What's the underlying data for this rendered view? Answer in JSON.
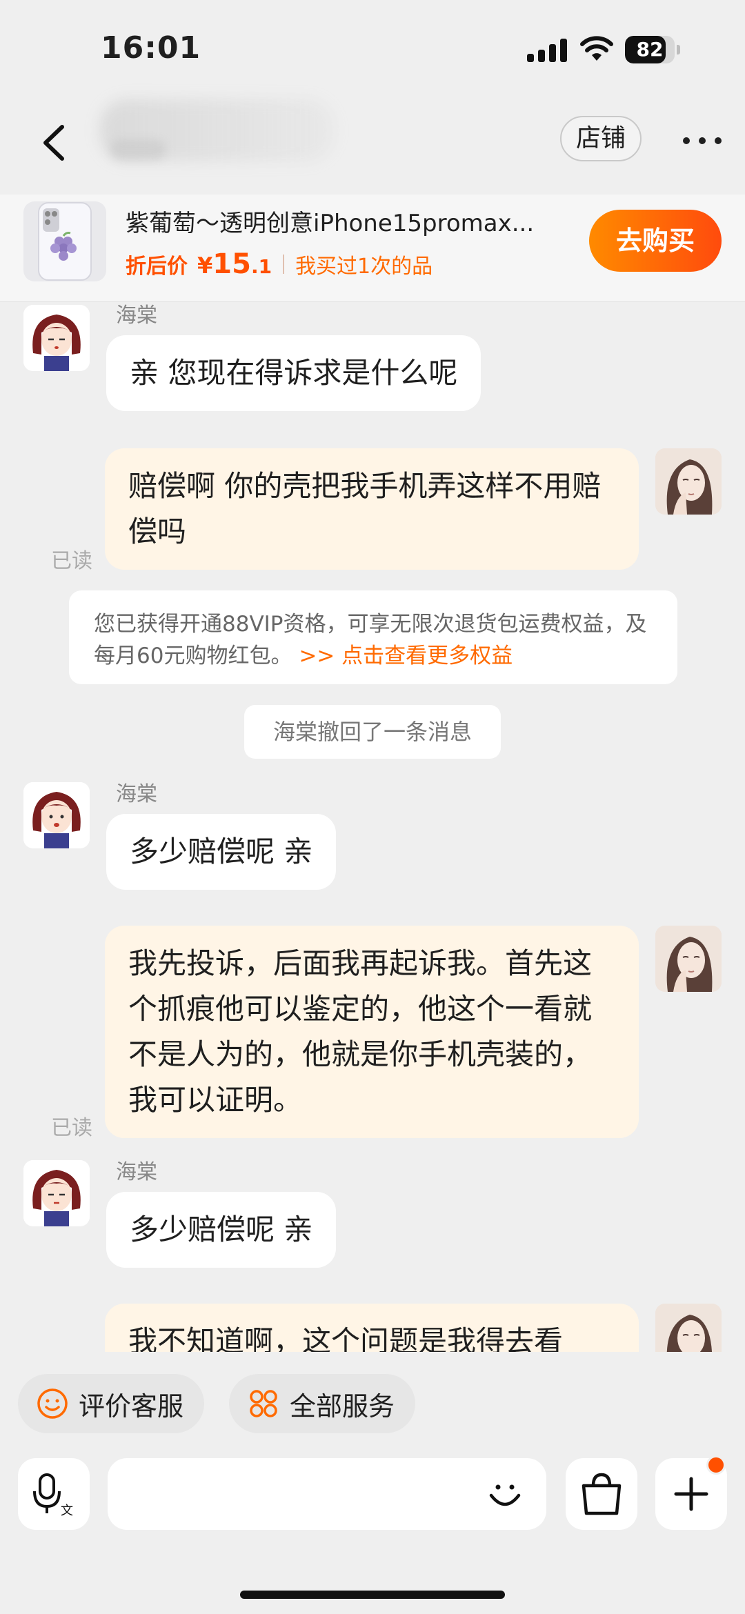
{
  "status_bar": {
    "time": "16:01",
    "battery": "82",
    "battery_level": 0.82
  },
  "header": {
    "store_label": "店铺"
  },
  "product": {
    "title": "紫葡萄～透明创意iPhone15promax...",
    "price_label": "折后价",
    "price_symbol": "¥",
    "price_integer": "15",
    "price_decimal": ".1",
    "bought_text": "我买过1次的品",
    "buy_label": "去购买"
  },
  "chat": {
    "agent_name": "海棠",
    "read_label": "已读",
    "messages": [
      {
        "sender": "agent",
        "text": "亲 您现在得诉求是什么呢"
      },
      {
        "sender": "user",
        "text": "赔偿啊 你的壳把我手机弄这样不用赔偿吗"
      },
      {
        "sender": "agent",
        "text": "多少赔偿呢 亲"
      },
      {
        "sender": "user",
        "text": "我先投诉，后面我再起诉我。首先这个抓痕他可以鉴定的，他这个一看就不是人为的，他就是你手机壳装的，我可以证明。"
      },
      {
        "sender": "agent",
        "text": "多少赔偿呢 亲"
      },
      {
        "sender": "user",
        "text": "我不知道啊，这个问题是我得去看"
      }
    ],
    "vip_notice": "您已获得开通88VIP资格，可享无限次退货包运费权益，及每月60元购物红包。",
    "vip_link": ">> 点击查看更多权益",
    "recall_notice": "海棠撤回了一条消息"
  },
  "quick_actions": {
    "rate_label": "评价客服",
    "services_label": "全部服务"
  },
  "input": {
    "placeholder": ""
  },
  "colors": {
    "accent": "#ff5000",
    "outgoing_bubble": "#fff5e6",
    "background": "#efefef"
  }
}
